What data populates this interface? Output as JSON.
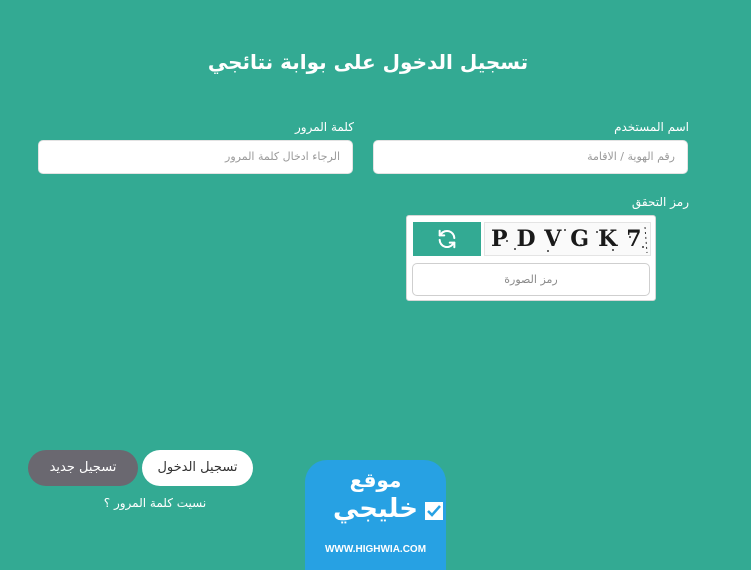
{
  "title": "تسجيل الدخول على بوابة نتائجي",
  "form": {
    "username_label": "اسم المستخدم",
    "username_placeholder": "رقم الهوية / الاقامة",
    "password_label": "كلمة المرور",
    "password_placeholder": "الرجاء ادخال كلمة المرور",
    "captcha_label": "رمز التحقق",
    "captcha_text": "PDVGK7",
    "captcha_placeholder": "رمز الصورة",
    "refresh_icon": "refresh-icon"
  },
  "actions": {
    "login_label": "تسجيل الدخول",
    "register_label": "تسجيل جديد",
    "forgot_label": "نسيت كلمة المرور ؟"
  },
  "watermark": {
    "line1": "موقع",
    "line2": "خليجي",
    "url": "WWW.HIGHWIA.COM"
  },
  "colors": {
    "background": "#33aa93",
    "register_button": "#6a6870",
    "watermark": "#27a1e3"
  }
}
